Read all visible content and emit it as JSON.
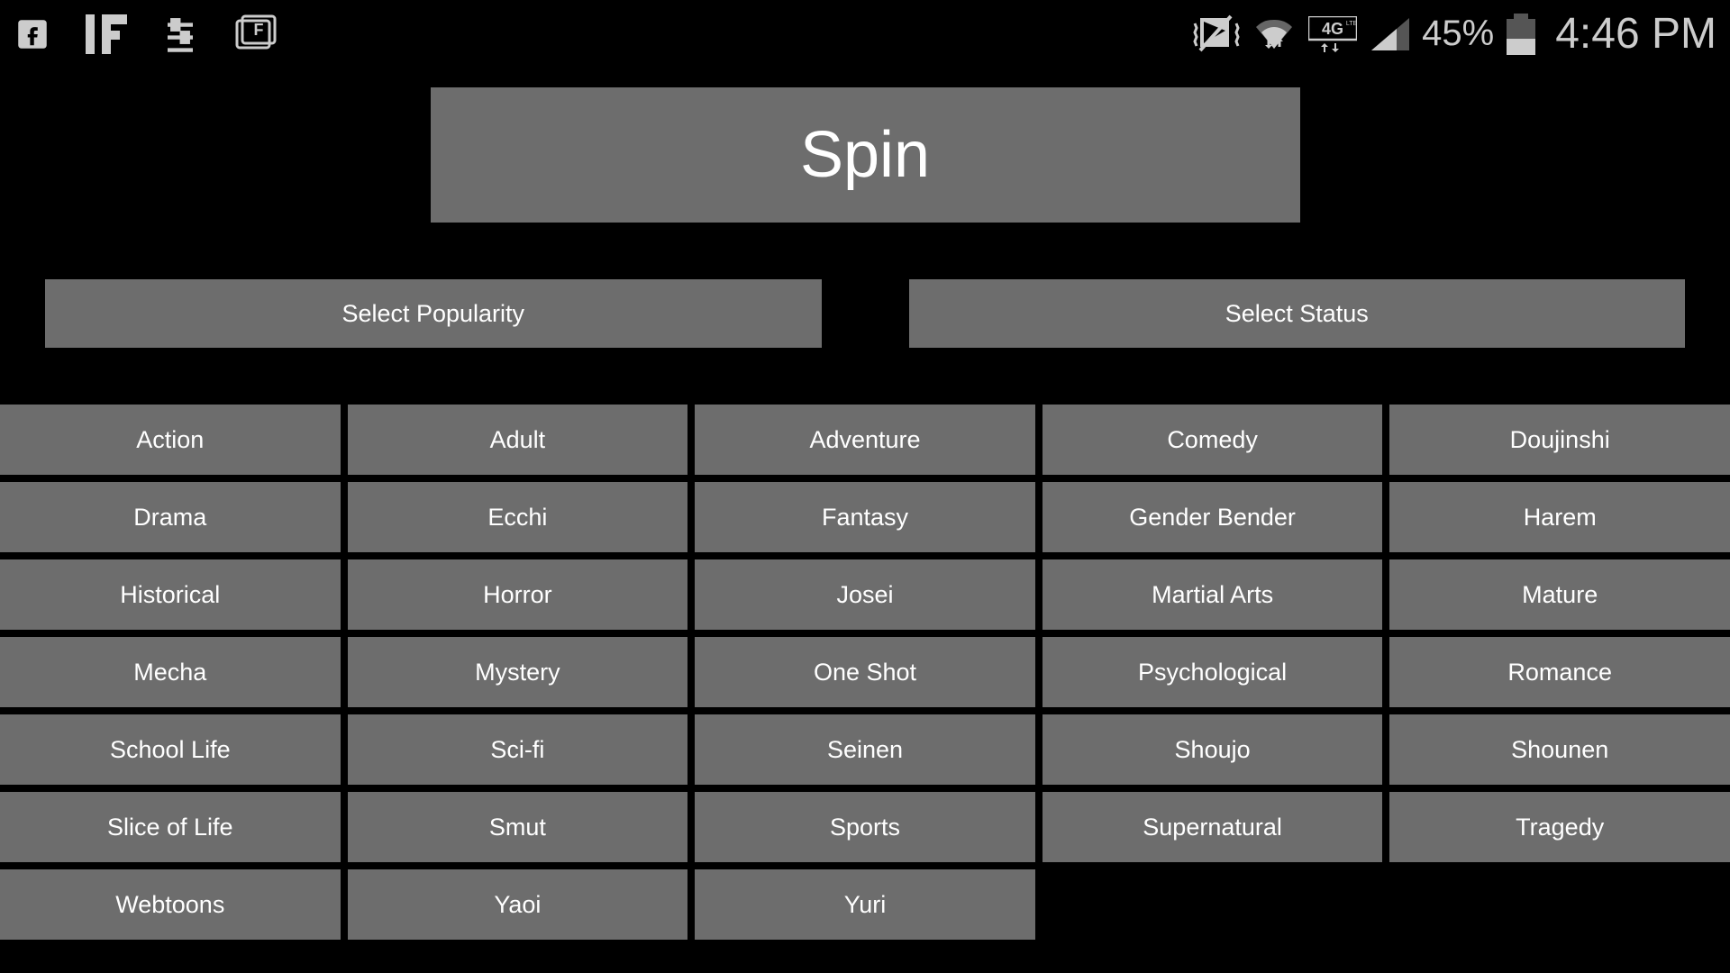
{
  "status_bar": {
    "battery_pct": "45%",
    "time": "4:46 PM",
    "network_label": "4G"
  },
  "spin": {
    "label": "Spin"
  },
  "selectors": {
    "popularity": "Select Popularity",
    "status": "Select Status"
  },
  "genres": [
    "Action",
    "Adult",
    "Adventure",
    "Comedy",
    "Doujinshi",
    "Drama",
    "Ecchi",
    "Fantasy",
    "Gender Bender",
    "Harem",
    "Historical",
    "Horror",
    "Josei",
    "Martial Arts",
    "Mature",
    "Mecha",
    "Mystery",
    "One Shot",
    "Psychological",
    "Romance",
    "School Life",
    "Sci-fi",
    "Seinen",
    "Shoujo",
    "Shounen",
    "Slice of Life",
    "Smut",
    "Sports",
    "Supernatural",
    "Tragedy",
    "Webtoons",
    "Yaoi",
    "Yuri"
  ]
}
